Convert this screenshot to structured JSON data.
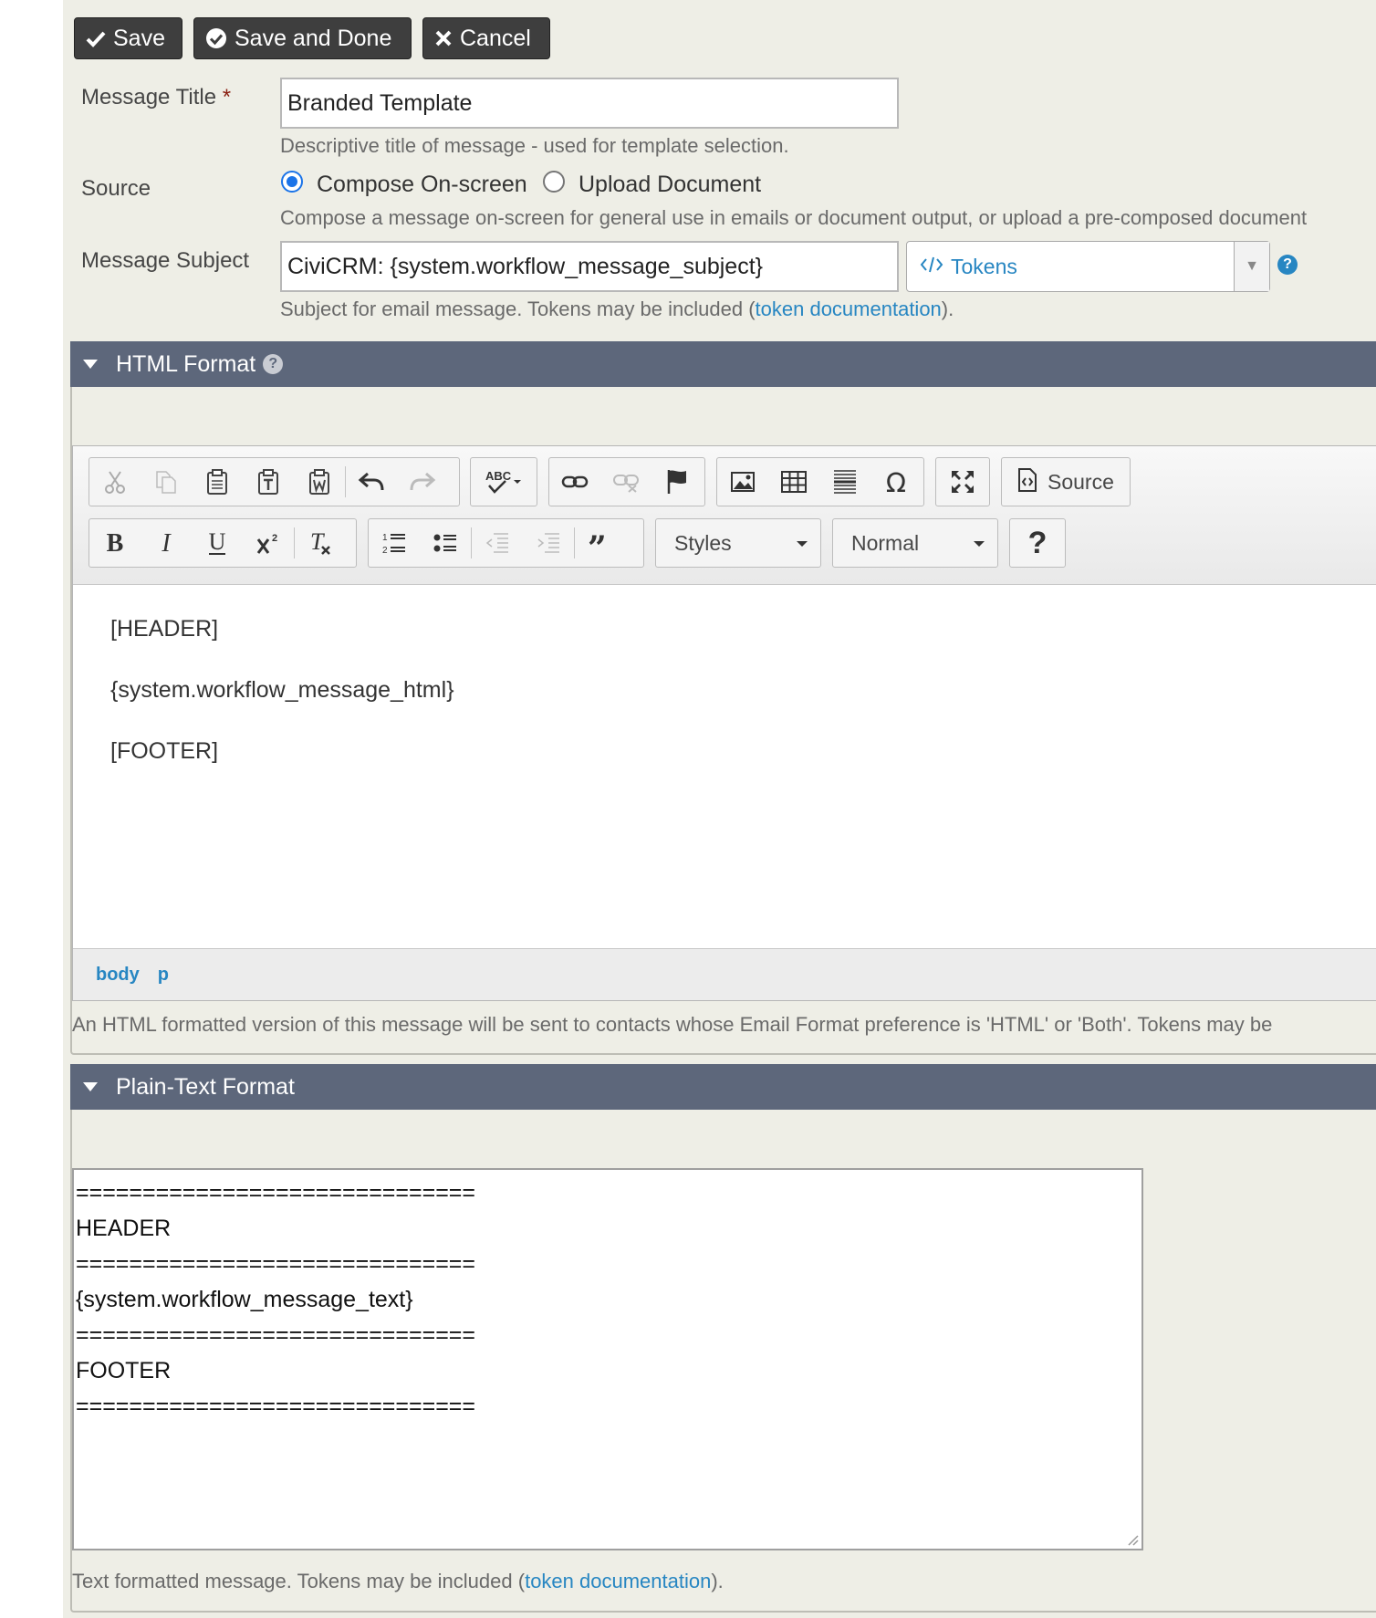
{
  "buttons": {
    "save": "Save",
    "save_done": "Save and Done",
    "cancel": "Cancel"
  },
  "title_field": {
    "label": "Message Title",
    "required_mark": "*",
    "value": "Branded Template",
    "help": "Descriptive title of message - used for template selection."
  },
  "source": {
    "label": "Source",
    "options": [
      "Compose On-screen",
      "Upload Document"
    ],
    "selected": "Compose On-screen",
    "help": "Compose a message on-screen for general use in emails or document output, or upload a pre-composed document"
  },
  "subject": {
    "label": "Message Subject",
    "value": "CiviCRM: {system.workflow_message_subject}",
    "tokens_label": "Tokens",
    "help_before": "Subject for email message. Tokens may be included (",
    "help_link": "token documentation",
    "help_after": ")."
  },
  "html_format": {
    "heading": "HTML Format",
    "editor": {
      "toolbar_row1_icons": [
        "cut-icon",
        "copy-icon",
        "paste-icon",
        "paste-text-icon",
        "paste-word-icon",
        "undo-icon",
        "redo-icon",
        "spellcheck-icon",
        "link-icon",
        "unlink-icon",
        "anchor-icon",
        "image-icon",
        "table-icon",
        "horizontal-rule-icon",
        "special-char-icon",
        "maximize-icon"
      ],
      "source_label": "Source",
      "toolbar_row2_icons": [
        "bold-icon",
        "italic-icon",
        "underline-icon",
        "superscript-icon",
        "remove-format-icon",
        "numbered-list-icon",
        "bulleted-list-icon",
        "outdent-icon",
        "indent-icon",
        "blockquote-icon",
        "help-icon"
      ],
      "styles_label": "Styles",
      "format_label": "Normal",
      "content": [
        "[HEADER]",
        "{system.workflow_message_html}",
        "[FOOTER]"
      ],
      "path": [
        "body",
        "p"
      ]
    },
    "help": "An HTML formatted version of this message will be sent to contacts whose Email Format preference is 'HTML' or 'Both'. Tokens may be"
  },
  "text_format": {
    "heading": "Plain-Text Format",
    "lines": [
      "==============================",
      "HEADER",
      "==============================",
      "{system.workflow_message_text}",
      "==============================",
      "FOOTER",
      "=============================="
    ],
    "help_before": "Text formatted message. Tokens may be included (",
    "help_link": "token documentation",
    "help_after": ")."
  },
  "colors": {
    "accordion_header": "#5d677b",
    "page_bg": "#eeeee6",
    "link": "#2786c2",
    "button_bg": "#3e3e3e",
    "radio_selected": "#1a73e8"
  }
}
